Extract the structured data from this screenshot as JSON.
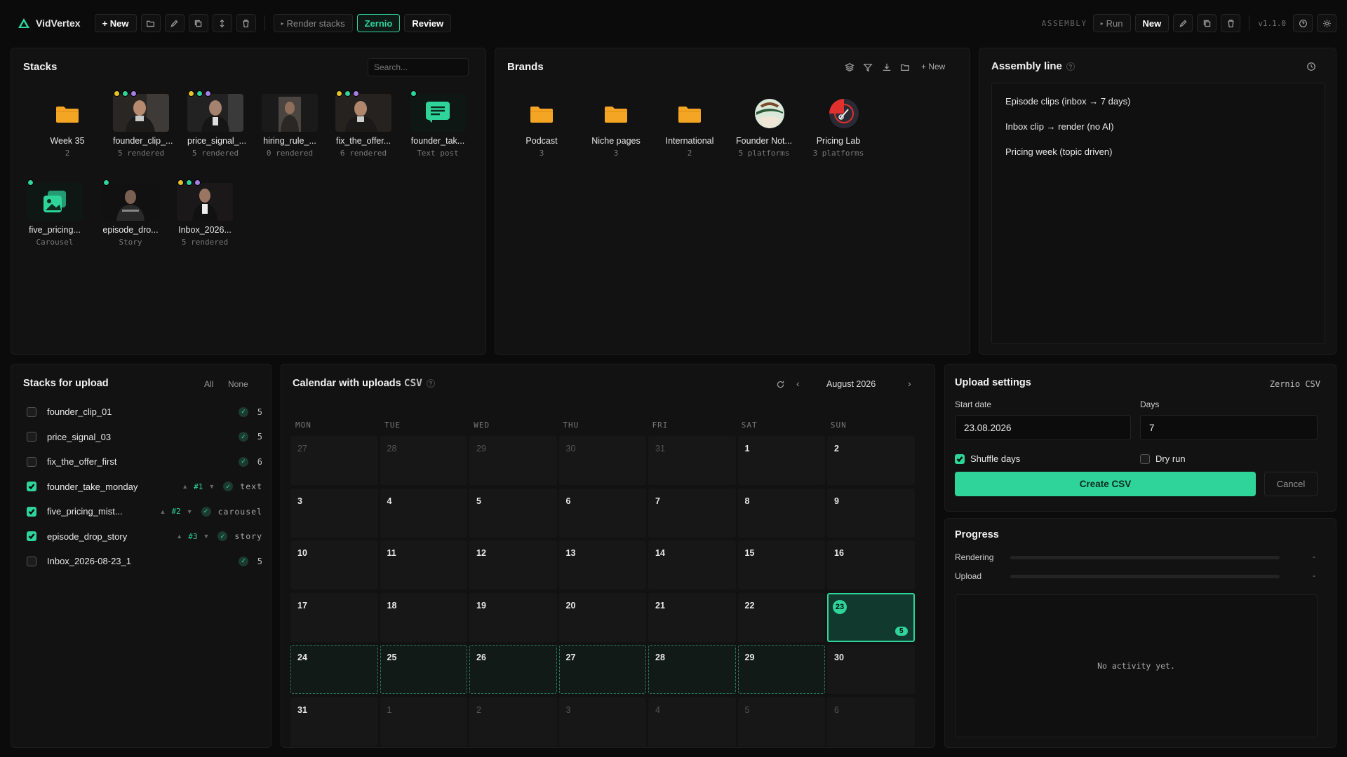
{
  "app": {
    "name": "VidVertex"
  },
  "toolbar": {
    "new_label": "+ New",
    "render_stacks": "Render stacks",
    "zernio": "Zernio",
    "review": "Review",
    "assembly_label": "ASSEMBLY",
    "run": "Run",
    "new2": "New",
    "version": "v1.1.0"
  },
  "stacks": {
    "title": "Stacks",
    "search_placeholder": "Search...",
    "items": [
      {
        "name": "Week 35",
        "sub": "2"
      },
      {
        "name": "founder_clip_...",
        "sub": "5 rendered"
      },
      {
        "name": "price_signal_...",
        "sub": "5 rendered"
      },
      {
        "name": "hiring_rule_...",
        "sub": "0 rendered"
      },
      {
        "name": "fix_the_offer...",
        "sub": "6 rendered"
      },
      {
        "name": "founder_tak...",
        "sub": "Text post"
      },
      {
        "name": "five_pricing...",
        "sub": "Carousel"
      },
      {
        "name": "episode_dro...",
        "sub": "Story"
      },
      {
        "name": "Inbox_2026...",
        "sub": "5 rendered"
      }
    ]
  },
  "brands": {
    "title": "Brands",
    "new_label": "+ New",
    "items": [
      {
        "name": "Podcast",
        "sub": "3"
      },
      {
        "name": "Niche pages",
        "sub": "3"
      },
      {
        "name": "International",
        "sub": "2"
      },
      {
        "name": "Founder Not...",
        "sub": "5 platforms"
      },
      {
        "name": "Pricing Lab",
        "sub": "3 platforms"
      }
    ]
  },
  "assembly": {
    "title": "Assembly line",
    "hint": "?",
    "items": [
      "Episode clips (inbox → 7 days)",
      "Inbox clip → render (no AI)",
      "Pricing week (topic driven)"
    ]
  },
  "upload_list": {
    "title": "Stacks for upload",
    "all": "All",
    "none": "None",
    "rows": [
      {
        "name": "founder_clip_01",
        "checked": false,
        "count": "5"
      },
      {
        "name": "price_signal_03",
        "checked": false,
        "count": "5"
      },
      {
        "name": "fix_the_offer_first",
        "checked": false,
        "count": "6"
      },
      {
        "name": "founder_take_monday",
        "checked": true,
        "order": "#1",
        "tag": "text"
      },
      {
        "name": "five_pricing_mist...",
        "checked": true,
        "order": "#2",
        "tag": "carousel"
      },
      {
        "name": "episode_drop_story",
        "checked": true,
        "order": "#3",
        "tag": "story"
      },
      {
        "name": "Inbox_2026-08-23_1",
        "checked": false,
        "count": "5"
      }
    ]
  },
  "calendar": {
    "title": "Calendar with uploads",
    "csv": "CSV",
    "hint": "?",
    "month": "August 2026",
    "dow": [
      "MON",
      "TUE",
      "WED",
      "THU",
      "FRI",
      "SAT",
      "SUN"
    ],
    "days": [
      "27",
      "28",
      "29",
      "30",
      "31",
      "1",
      "2",
      "3",
      "4",
      "5",
      "6",
      "7",
      "8",
      "9",
      "10",
      "11",
      "12",
      "13",
      "14",
      "15",
      "16",
      "17",
      "18",
      "19",
      "20",
      "21",
      "22",
      "23",
      "24",
      "25",
      "26",
      "27",
      "28",
      "29",
      "30",
      "31",
      "1",
      "2",
      "3",
      "4",
      "5",
      "6"
    ],
    "today_badge": "5"
  },
  "upload_settings": {
    "title": "Upload settings",
    "mode": "Zernio CSV",
    "start_label": "Start date",
    "start_value": "23.08.2026",
    "days_label": "Days",
    "days_value": "7",
    "shuffle": "Shuffle days",
    "dry_run": "Dry run",
    "create": "Create CSV",
    "cancel": "Cancel"
  },
  "progress": {
    "title": "Progress",
    "rendering": "Rendering",
    "upload": "Upload",
    "rendering_value": "-",
    "upload_value": "-",
    "empty": "No activity yet."
  },
  "colors": {
    "accent": "#2fd49b",
    "folder": "#f5a524"
  }
}
